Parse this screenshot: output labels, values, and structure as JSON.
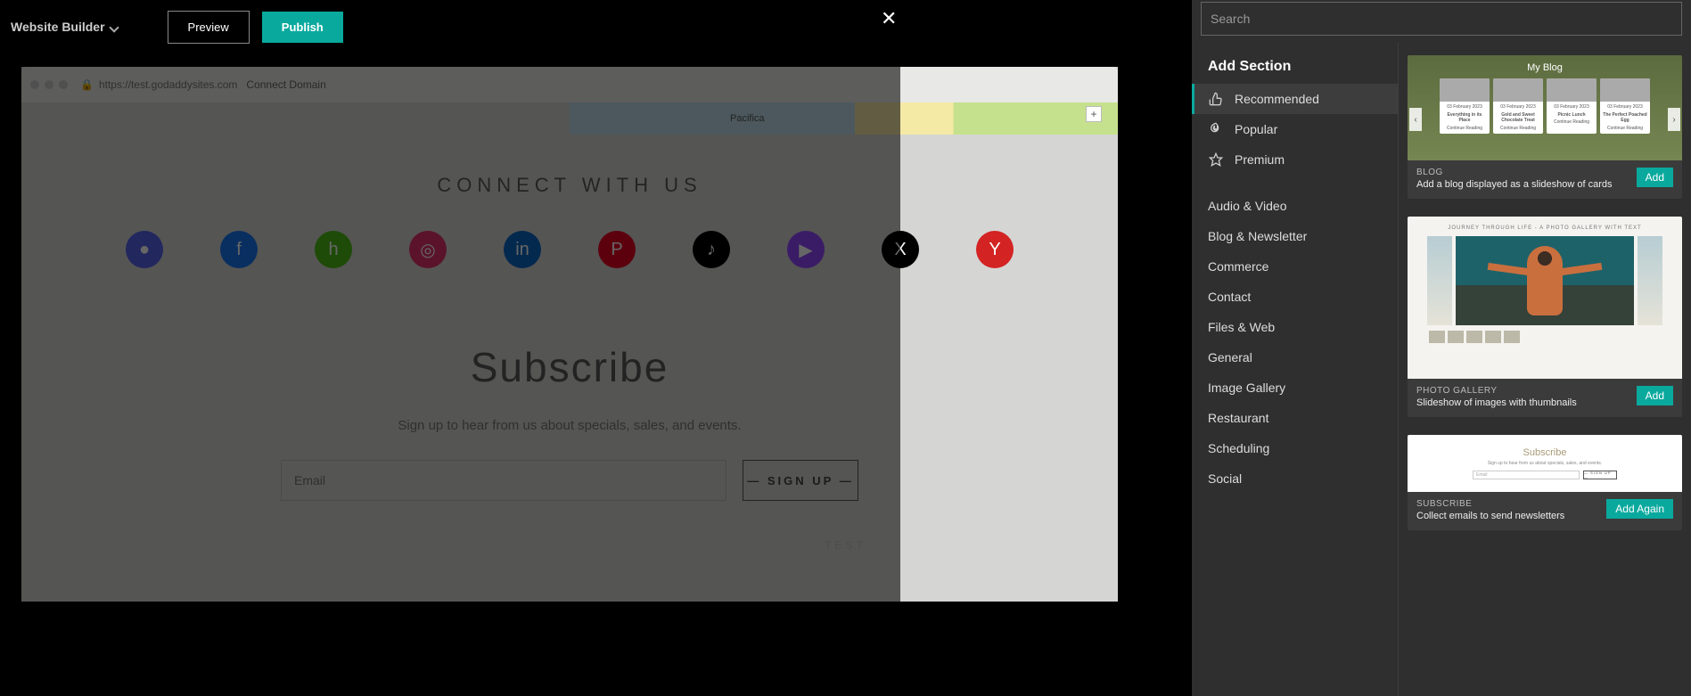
{
  "header": {
    "app": "Website Builder",
    "preview": "Preview",
    "publish": "Publish"
  },
  "browser": {
    "url": "https://test.godaddysites.com",
    "connect": "Connect Domain"
  },
  "page": {
    "map_city": "Pacifica",
    "connect_heading": "CONNECT WITH US",
    "subscribe_heading": "Subscribe",
    "subscribe_caption": "Sign up to hear from us about specials, sales, and events.",
    "email_placeholder": "Email",
    "signup_btn": "— SIGN UP —",
    "footer": "TEST"
  },
  "panel": {
    "search_placeholder": "Search",
    "title": "Add Section",
    "top": [
      {
        "label": "Recommended"
      },
      {
        "label": "Popular"
      },
      {
        "label": "Premium"
      }
    ],
    "categories": [
      "Audio & Video",
      "Blog & Newsletter",
      "Commerce",
      "Contact",
      "Files & Web",
      "General",
      "Image Gallery",
      "Restaurant",
      "Scheduling",
      "Social"
    ]
  },
  "cards": {
    "blog": {
      "title": "My Blog",
      "items": [
        "Everything in its Place",
        "Gold and Sweet Chocolate Treat",
        "Picnic Lunch",
        "The Perfect Poached Egg"
      ],
      "date": "03 February 2023",
      "cont": "Continue Reading",
      "cat": "BLOG",
      "desc": "Add a blog displayed as a slideshow of cards",
      "btn": "Add"
    },
    "gallery": {
      "title": "JOURNEY THROUGH LIFE - A PHOTO GALLERY WITH TEXT",
      "cat": "PHOTO GALLERY",
      "desc": "Slideshow of images with thumbnails",
      "btn": "Add"
    },
    "subscribe": {
      "title": "Subscribe",
      "caption": "Sign up to hear from us about specials, sales, and events.",
      "email": "Email",
      "signup": "— SIGN UP —",
      "cat": "SUBSCRIBE",
      "desc": "Collect emails to send newsletters",
      "btn": "Add Again"
    }
  },
  "social": [
    {
      "name": "discord",
      "color": "#5562ea",
      "glyph": "●"
    },
    {
      "name": "facebook",
      "color": "#1877f2",
      "glyph": "f"
    },
    {
      "name": "houzz",
      "color": "#4dbc15",
      "glyph": "h"
    },
    {
      "name": "instagram",
      "color": "#e1306c",
      "glyph": "◎"
    },
    {
      "name": "linkedin",
      "color": "#0a66c2",
      "glyph": "in"
    },
    {
      "name": "pinterest",
      "color": "#e60023",
      "glyph": "P"
    },
    {
      "name": "tiktok",
      "color": "#000",
      "glyph": "♪"
    },
    {
      "name": "twitch",
      "color": "#9146ff",
      "glyph": "▶"
    },
    {
      "name": "x",
      "color": "#000",
      "glyph": "X"
    },
    {
      "name": "yelp",
      "color": "#d32323",
      "glyph": "Y"
    }
  ]
}
